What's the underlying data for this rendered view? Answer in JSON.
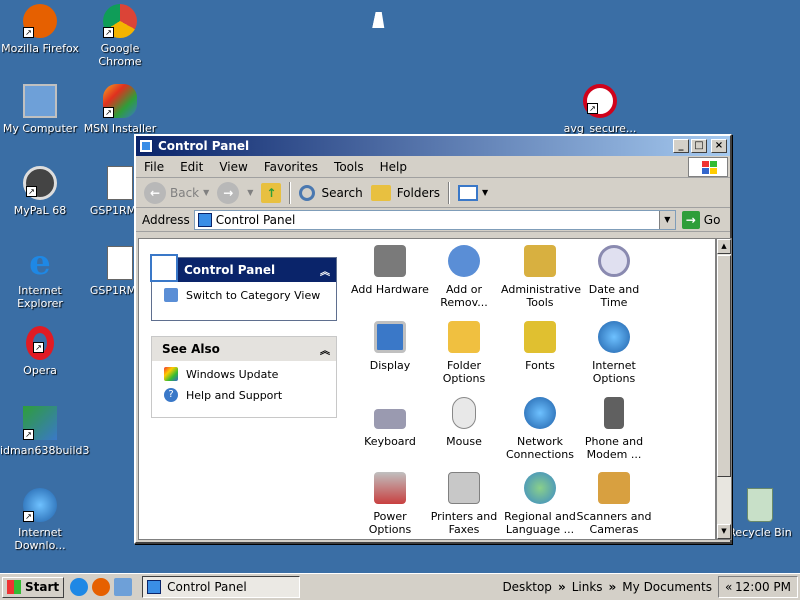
{
  "desktop": {
    "icons": [
      {
        "label": "Mozilla Firefox",
        "icon": "firefox-icon",
        "color": "#e66000"
      },
      {
        "label": "Google Chrome",
        "icon": "chrome-icon",
        "color": "#4285f4"
      },
      {
        "label": "My Computer",
        "icon": "computer-icon",
        "color": "#6ea0d8"
      },
      {
        "label": "MSN Installer",
        "icon": "msn-icon",
        "color": "#f5a623"
      },
      {
        "label": "avg_secure...",
        "icon": "avg-icon",
        "color": "#d0021b"
      },
      {
        "label": "MyPaL 68",
        "icon": "mypal-icon",
        "color": "#444444"
      },
      {
        "label": "GSP1RMCF",
        "icon": "document-icon",
        "color": "#ffffff"
      },
      {
        "label": "Internet Explorer",
        "icon": "ie-icon",
        "color": "#1e88e5"
      },
      {
        "label": "GSP1RMCF",
        "icon": "document-icon",
        "color": "#ffffff"
      },
      {
        "label": "Opera",
        "icon": "opera-icon",
        "color": "#e01b24"
      },
      {
        "label": "idman638build3",
        "icon": "installer-icon",
        "color": "#2e9e3a"
      },
      {
        "label": "Internet Downlo...",
        "icon": "idm-icon",
        "color": "#2e9e3a"
      },
      {
        "label": "Recycle Bin",
        "icon": "recycle-bin-icon",
        "color": "#c8e0c8"
      }
    ]
  },
  "window": {
    "title": "Control Panel",
    "menu": [
      "File",
      "Edit",
      "View",
      "Favorites",
      "Tools",
      "Help"
    ],
    "toolbar": {
      "back": "Back",
      "search": "Search",
      "folders": "Folders"
    },
    "address": {
      "label": "Address",
      "value": "Control Panel",
      "go": "Go"
    },
    "task_panel": {
      "title": "Control Panel",
      "link": "Switch to Category View"
    },
    "see_also": {
      "title": "See Also",
      "links": [
        "Windows Update",
        "Help and Support"
      ]
    },
    "items": [
      {
        "label": "Add Hardware",
        "icon": "add-hardware-icon",
        "color": "#7a7a7a"
      },
      {
        "label": "Add or Remov...",
        "icon": "add-remove-programs-icon",
        "color": "#5a8ed6"
      },
      {
        "label": "Administrative Tools",
        "icon": "admin-tools-icon",
        "color": "#d8b040"
      },
      {
        "label": "Date and Time",
        "icon": "clock-icon",
        "color": "#c0c0d8"
      },
      {
        "label": "Display",
        "icon": "display-icon",
        "color": "#3a78c8"
      },
      {
        "label": "Folder Options",
        "icon": "folder-options-icon",
        "color": "#f0c040"
      },
      {
        "label": "Fonts",
        "icon": "fonts-icon",
        "color": "#e0c030"
      },
      {
        "label": "Internet Options",
        "icon": "internet-options-icon",
        "color": "#3a9a4a"
      },
      {
        "label": "Keyboard",
        "icon": "keyboard-icon",
        "color": "#9a9ab0"
      },
      {
        "label": "Mouse",
        "icon": "mouse-icon",
        "color": "#d8d8d8"
      },
      {
        "label": "Network Connections",
        "icon": "network-icon",
        "color": "#3a78c8"
      },
      {
        "label": "Phone and Modem ...",
        "icon": "phone-modem-icon",
        "color": "#606060"
      },
      {
        "label": "Power Options",
        "icon": "power-options-icon",
        "color": "#c84040"
      },
      {
        "label": "Printers and Faxes",
        "icon": "printer-icon",
        "color": "#a0a0a0"
      },
      {
        "label": "Regional and Language ...",
        "icon": "globe-icon",
        "color": "#3a88c8"
      },
      {
        "label": "Scanners and Cameras",
        "icon": "scanner-icon",
        "color": "#d8a040"
      }
    ]
  },
  "taskbar": {
    "start": "Start",
    "task": "Control Panel",
    "desktop": "Desktop",
    "links": "Links",
    "my_documents": "My Documents",
    "expand": "«",
    "chev1": "»",
    "chev2": "»",
    "clock": "12:00 PM"
  }
}
